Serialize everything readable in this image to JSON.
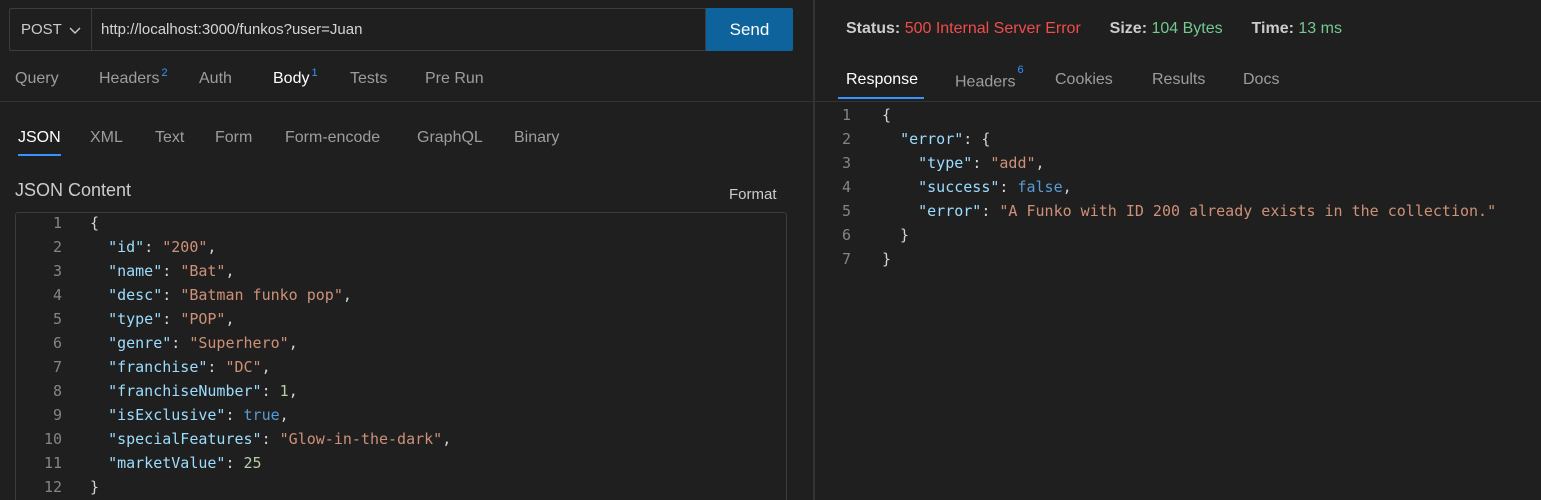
{
  "request": {
    "method": "POST",
    "url": "http://localhost:3000/funkos?user=Juan",
    "send_label": "Send",
    "tabs": [
      {
        "label": "Query",
        "badge": ""
      },
      {
        "label": "Headers",
        "badge": "2"
      },
      {
        "label": "Auth",
        "badge": ""
      },
      {
        "label": "Body",
        "badge": "1"
      },
      {
        "label": "Tests",
        "badge": ""
      },
      {
        "label": "Pre Run",
        "badge": ""
      }
    ],
    "active_tab": "Body",
    "body_tabs": [
      "JSON",
      "XML",
      "Text",
      "Form",
      "Form-encode",
      "GraphQL",
      "Binary"
    ],
    "active_body_tab": "JSON",
    "content_title": "JSON Content",
    "format_label": "Format",
    "line_numbers": [
      "1",
      "2",
      "3",
      "4",
      "5",
      "6",
      "7",
      "8",
      "9",
      "10",
      "11",
      "12"
    ],
    "body_lines": [
      "{",
      "  \"id\": \"200\",",
      "  \"name\": \"Bat\",",
      "  \"desc\": \"Batman funko pop\",",
      "  \"type\": \"POP\",",
      "  \"genre\": \"Superhero\",",
      "  \"franchise\": \"DC\",",
      "  \"franchiseNumber\": 1,",
      "  \"isExclusive\": true,",
      "  \"specialFeatures\": \"Glow-in-the-dark\",",
      "  \"marketValue\": 25",
      "}"
    ]
  },
  "response": {
    "status_label": "Status:",
    "status_value": "500 Internal Server Error",
    "size_label": "Size:",
    "size_value": "104 Bytes",
    "time_label": "Time:",
    "time_value": "13 ms",
    "tabs": [
      {
        "label": "Response",
        "badge": ""
      },
      {
        "label": "Headers",
        "badge": "6"
      },
      {
        "label": "Cookies",
        "badge": ""
      },
      {
        "label": "Results",
        "badge": ""
      },
      {
        "label": "Docs",
        "badge": ""
      }
    ],
    "active_tab": "Response",
    "line_numbers": [
      "1",
      "2",
      "3",
      "4",
      "5",
      "6",
      "7"
    ],
    "body_lines": [
      "{",
      "  \"error\": {",
      "    \"type\": \"add\",",
      "    \"success\": false,",
      "    \"error\": \"A Funko with ID 200 already exists in the collection.\"",
      "  }",
      "}"
    ]
  },
  "colors": {
    "accent": "#3794ff",
    "send_button": "#0e639c",
    "status_error": "#f14c4c",
    "status_ok": "#73c991",
    "background": "#1f1f1f"
  },
  "icons": {
    "method_dropdown": "chevron-down-icon"
  }
}
